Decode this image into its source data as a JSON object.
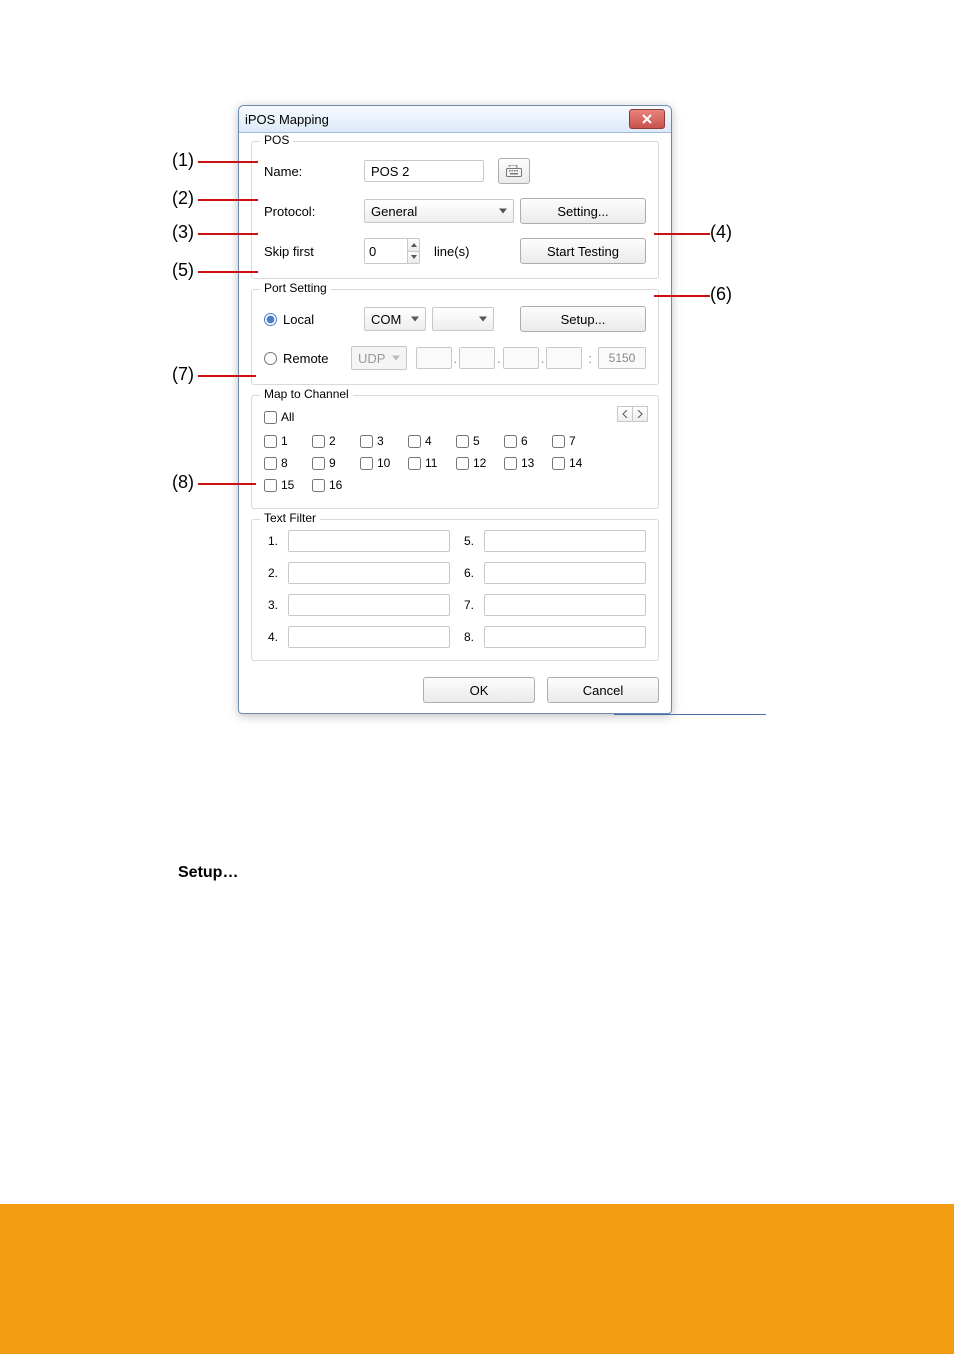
{
  "page": {
    "setup_heading": "Setup…"
  },
  "dialog": {
    "title": "iPOS Mapping",
    "pos": {
      "legend": "POS",
      "name_label": "Name:",
      "name_value": "POS 2",
      "protocol_label": "Protocol:",
      "protocol_value": "General",
      "setting_btn": "Setting...",
      "skip_label": "Skip  first",
      "skip_value": "0",
      "skip_unit": "line(s)",
      "start_testing_btn": "Start Testing"
    },
    "port": {
      "legend": "Port Setting",
      "local_label": "Local",
      "remote_label": "Remote",
      "local_proto": "COM",
      "remote_proto": "UDP",
      "remote_port": "5150",
      "setup_btn": "Setup..."
    },
    "map": {
      "legend": "Map to Channel",
      "all_label": "All",
      "channels": [
        "1",
        "2",
        "3",
        "4",
        "5",
        "6",
        "7",
        "8",
        "9",
        "10",
        "11",
        "12",
        "13",
        "14",
        "15",
        "16"
      ]
    },
    "filter": {
      "legend": "Text Filter",
      "nums": [
        "1.",
        "2.",
        "3.",
        "4.",
        "5.",
        "6.",
        "7.",
        "8."
      ]
    },
    "buttons": {
      "ok": "OK",
      "cancel": "Cancel"
    }
  },
  "callouts": {
    "c1": "(1)",
    "c2": "(2)",
    "c3": "(3)",
    "c4": "(4)",
    "c5": "(5)",
    "c6": "(6)",
    "c7": "(7)",
    "c8": "(8)"
  }
}
